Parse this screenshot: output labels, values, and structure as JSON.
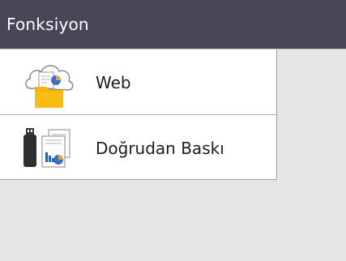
{
  "header": {
    "title": "Fonksiyon"
  },
  "menu": {
    "items": [
      {
        "label": "Web",
        "icon": "web-cloud-folder-icon"
      },
      {
        "label": "Doğrudan Baskı",
        "icon": "usb-direct-print-icon"
      }
    ]
  },
  "colors": {
    "header_bg": "#4a4658",
    "background": "#e6e6e6",
    "folder": "#f5b400"
  }
}
